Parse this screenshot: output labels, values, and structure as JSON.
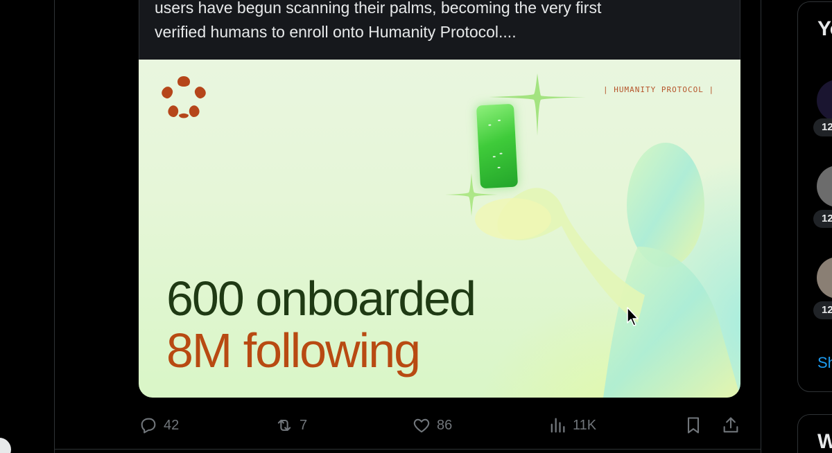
{
  "tweet": {
    "text": "users have begun scanning their palms, becoming the very first\nverified humans to enroll onto Humanity Protocol...."
  },
  "media": {
    "brand_tag": "| HUMANITY PROTOCOL |",
    "headline_1": "600 onboarded",
    "headline_2": "8M following",
    "colors": {
      "headline_1": "#1f3a14",
      "headline_2": "#b84a12",
      "brand": "#b5542a",
      "phone": "#3fcb3a"
    }
  },
  "actions": {
    "reply_count": "42",
    "repost_count": "7",
    "like_count": "86",
    "views_count": "11K",
    "icons": [
      "reply-icon",
      "repost-icon",
      "like-icon",
      "views-icon",
      "bookmark-icon",
      "share-icon"
    ]
  },
  "sidebar": {
    "title_partial": "Yo",
    "counts": [
      "12",
      "12",
      "12"
    ],
    "show_more_partial": "Sh",
    "second_title_partial": "W"
  }
}
